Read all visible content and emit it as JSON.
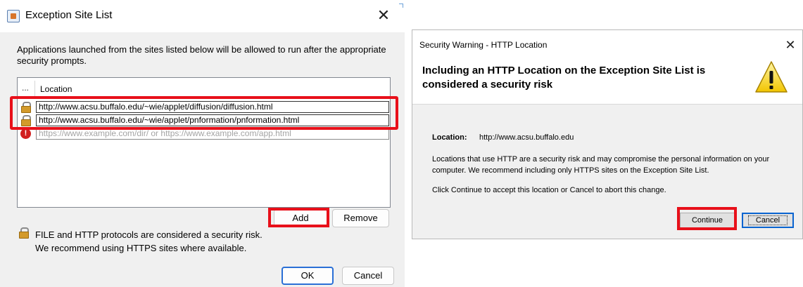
{
  "exception_dialog": {
    "title": "Exception Site List",
    "close_glyph": "✕",
    "description": "Applications launched from the sites listed below will be allowed to run after the appropriate security prompts.",
    "table": {
      "columns": [
        "...",
        "Location"
      ],
      "rows": [
        {
          "icon": "lock-warning-icon",
          "value": "http://www.acsu.buffalo.edu/~wie/applet/diffusion/diffusion.html"
        },
        {
          "icon": "lock-warning-icon",
          "value": "http://www.acsu.buffalo.edu/~wie/applet/pnformation/pnformation.html"
        }
      ],
      "new_entry": {
        "icon": "error-icon",
        "icon_glyph": "!",
        "placeholder": "https://www.example.com/dir/ or https://www.example.com/app.html"
      }
    },
    "buttons": {
      "add": "Add",
      "remove": "Remove",
      "ok": "OK",
      "cancel": "Cancel"
    },
    "footnote_line1": "FILE and HTTP protocols are considered a security risk.",
    "footnote_line2": "We recommend using HTTPS sites where available.",
    "highlight_color": "#e8101a"
  },
  "security_dialog": {
    "title": "Security Warning - HTTP Location",
    "close_glyph": "✕",
    "heading": "Including an HTTP Location on the Exception Site List is considered a security risk",
    "warning_icon": "warning-triangle-icon",
    "location_label": "Location:",
    "location_value": "http://www.acsu.buffalo.edu",
    "body": "Locations that use HTTP are a security risk and may compromise the personal information on your computer.  We recommend including only HTTPS sites on the Exception Site List.",
    "instruction": "Click Continue to accept this location or Cancel to abort this change.",
    "buttons": {
      "continue": "Continue",
      "cancel": "Cancel"
    }
  }
}
